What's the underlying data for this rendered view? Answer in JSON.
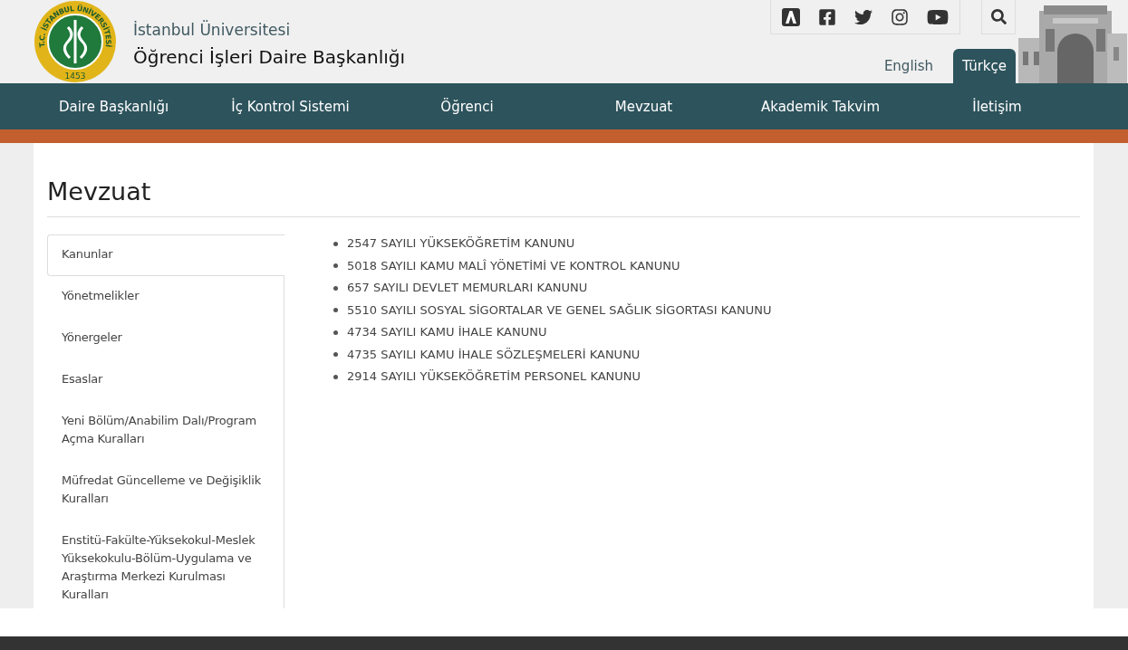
{
  "logo": {
    "ring_text": "T.C. İSTANBUL ÜNİVERSİTESİ",
    "year": "1453"
  },
  "header": {
    "subtitle": "İstanbul Üniversitesi",
    "title": "Öğrenci İşleri Daire Başkanlığı"
  },
  "social": [
    {
      "kind": "a"
    },
    {
      "kind": "facebook"
    },
    {
      "kind": "twitter"
    },
    {
      "kind": "instagram"
    },
    {
      "kind": "youtube"
    }
  ],
  "languages": [
    {
      "label": "English",
      "selected": false
    },
    {
      "label": "Türkçe",
      "selected": true
    }
  ],
  "nav": [
    "Daire Başkanlığı",
    "İç Kontrol Sistemi",
    "Öğrenci",
    "Mevzuat",
    "Akademik Takvim",
    "İletişim"
  ],
  "page_title": "Mevzuat",
  "sidebar": [
    {
      "label": "Kanunlar",
      "selected": true
    },
    {
      "label": "Yönetmelikler",
      "selected": false
    },
    {
      "label": "Yönergeler",
      "selected": false
    },
    {
      "label": "Esaslar",
      "selected": false
    },
    {
      "label": "Yeni Bölüm/Anabilim Dalı/Program Açma Kuralları",
      "selected": false
    },
    {
      "label": "Müfredat Güncelleme ve Değişiklik Kuralları",
      "selected": false
    },
    {
      "label": "Enstitü-Fakülte-Yüksekokul-Meslek Yüksekokulu-Bölüm-Uygulama ve Araştırma Merkezi Kurulması Kuralları",
      "selected": false
    }
  ],
  "laws": [
    "2547 SAYILI YÜKSEKÖĞRETİM KANUNU",
    "5018 SAYILI KAMU MALÎ YÖNETİMİ VE KONTROL KANUNU",
    "657 SAYILI DEVLET MEMURLARI KANUNU",
    "5510 SAYILI SOSYAL SİGORTALAR VE GENEL SAĞLIK SİGORTASI KANUNU",
    "4734 SAYILI KAMU İHALE KANUNU",
    "4735 SAYILI KAMU İHALE SÖZLEŞMELERİ KANUNU",
    "2914 SAYILI YÜKSEKÖĞRETİM PERSONEL KANUNU"
  ]
}
